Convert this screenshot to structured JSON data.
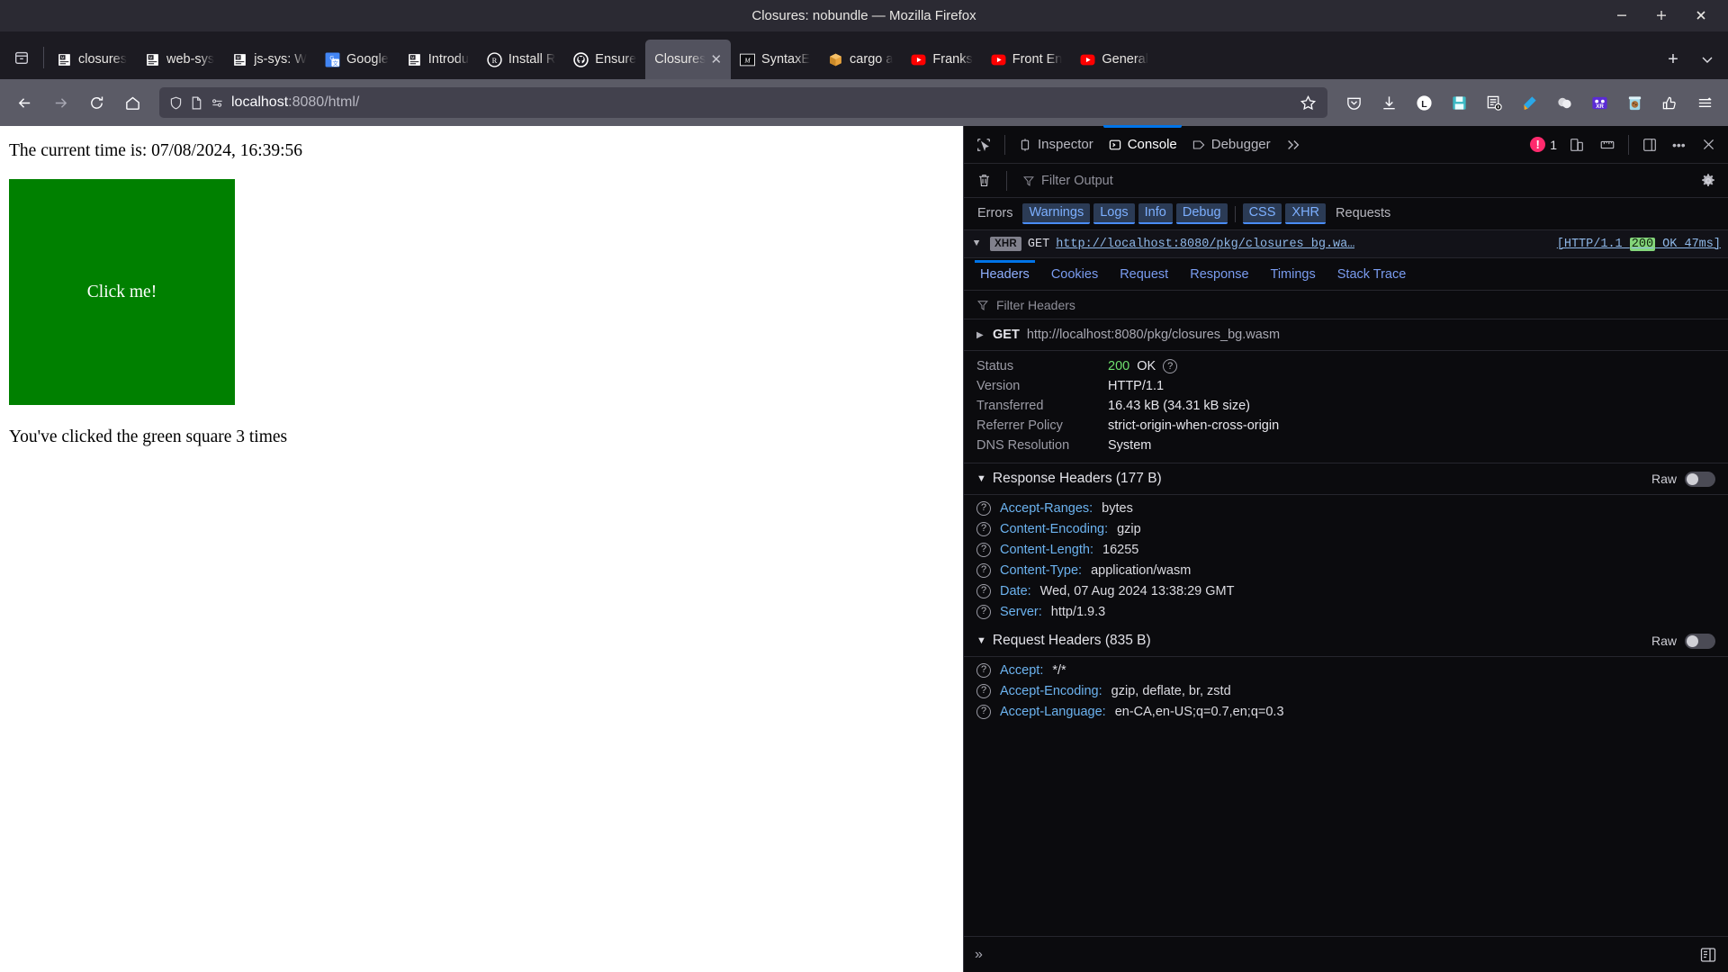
{
  "window": {
    "title": "Closures: nobundle — Mozilla Firefox",
    "minimize_label": "–",
    "maximize_label": "+",
    "close_label": "✕"
  },
  "tabstrip": {
    "list_all_tabs_label": "⌄",
    "new_tab_label": "+",
    "tabs": [
      {
        "title": "closures",
        "favicon": "book-icon",
        "active": false
      },
      {
        "title": "web-sys",
        "favicon": "book-icon",
        "active": false
      },
      {
        "title": "js-sys: W",
        "favicon": "book-icon",
        "active": false
      },
      {
        "title": "Google",
        "favicon": "google-translate-icon",
        "active": false
      },
      {
        "title": "Introdu",
        "favicon": "book-icon",
        "active": false
      },
      {
        "title": "Install R",
        "favicon": "rust-icon",
        "active": false
      },
      {
        "title": "Ensure",
        "favicon": "github-icon",
        "active": false
      },
      {
        "title": "Closures",
        "favicon": "none",
        "active": true,
        "close_label": "✕"
      },
      {
        "title": "SyntaxE",
        "favicon": "mdn-icon",
        "active": false
      },
      {
        "title": "cargo a",
        "favicon": "package-icon",
        "active": false
      },
      {
        "title": "Franks",
        "favicon": "youtube-icon",
        "active": false
      },
      {
        "title": "Front En",
        "favicon": "youtube-icon",
        "active": false
      },
      {
        "title": "General",
        "favicon": "youtube-icon",
        "active": false
      }
    ]
  },
  "navbar": {
    "back_label": "←",
    "forward_label": "→",
    "reload_label": "⟳",
    "home_label": "⌂",
    "url_host": "localhost",
    "url_path": ":8080/html/",
    "url_full": "localhost:8080/html/",
    "bookmark_label": "☆",
    "toolbar_icons": [
      "pocket-icon",
      "downloads-icon",
      "lastpass-icon",
      "save-page-icon",
      "readability-icon",
      "highlighter-icon",
      "ghost-privacy-icon",
      "webxr-icon",
      "cookie-jar-icon",
      "thumbs-up-icon",
      "app-menu-icon"
    ]
  },
  "page": {
    "time_text": "The current time is: 07/08/2024, 16:39:56",
    "button_label": "Click me!",
    "button_color": "#008000",
    "click_text": "You've clicked the green square 3 times"
  },
  "devtools": {
    "toolbar": {
      "picker_icon": "element-picker-icon",
      "panels": [
        {
          "label": "Inspector",
          "icon": "inspector-icon",
          "selected": false
        },
        {
          "label": "Console",
          "icon": "console-icon",
          "selected": true
        },
        {
          "label": "Debugger",
          "icon": "debugger-icon",
          "selected": false
        }
      ],
      "more_panels_label": "»",
      "error_count": "1",
      "error_badge_glyph": "!",
      "responsive_icon": "responsive-design-mode-icon",
      "ruler_icon": "measure-icon",
      "split_icon": "split-console-icon",
      "meatball_label": "•••",
      "close_label": "✕"
    },
    "filterbar": {
      "clear_icon": "trash-icon",
      "filter_placeholder": "Filter Output",
      "settings_icon": "gear-icon"
    },
    "levels": [
      {
        "label": "Errors",
        "active": false
      },
      {
        "label": "Warnings",
        "active": true
      },
      {
        "label": "Logs",
        "active": true
      },
      {
        "label": "Info",
        "active": true
      },
      {
        "label": "Debug",
        "active": true
      },
      {
        "label": "CSS",
        "active": true
      },
      {
        "label": "XHR",
        "active": true
      },
      {
        "label": "Requests",
        "active": false
      }
    ],
    "message": {
      "twisty": "▼",
      "badge": "XHR",
      "method": "GET",
      "url": "http://localhost:8080/pkg/closures_bg.wa…",
      "status_prefix": "[HTTP/1.1 ",
      "status_code": "200",
      "status_suffix": " OK 47ms]"
    },
    "net_tabs": [
      {
        "label": "Headers",
        "active": true
      },
      {
        "label": "Cookies",
        "active": false
      },
      {
        "label": "Request",
        "active": false
      },
      {
        "label": "Response",
        "active": false
      },
      {
        "label": "Timings",
        "active": false
      },
      {
        "label": "Stack Trace",
        "active": false
      }
    ],
    "headers_filter_placeholder": "Filter Headers",
    "request_line": {
      "twisty": "▶",
      "method": "GET",
      "url": "http://localhost:8080/pkg/closures_bg.wasm"
    },
    "summary": [
      {
        "label": "Status",
        "value": "200",
        "value2": "OK",
        "has_help": true
      },
      {
        "label": "Version",
        "value": "HTTP/1.1",
        "has_help": false
      },
      {
        "label": "Transferred",
        "value": "16.43 kB (34.31 kB size)",
        "has_help": false
      },
      {
        "label": "Referrer Policy",
        "value": "strict-origin-when-cross-origin",
        "has_help": false
      },
      {
        "label": "DNS Resolution",
        "value": "System",
        "has_help": false
      }
    ],
    "response_headers": {
      "title": "Response Headers (177 B)",
      "twisty": "▼",
      "raw_label": "Raw",
      "rows": [
        {
          "name": "Accept-Ranges:",
          "value": "bytes"
        },
        {
          "name": "Content-Encoding:",
          "value": "gzip"
        },
        {
          "name": "Content-Length:",
          "value": "16255"
        },
        {
          "name": "Content-Type:",
          "value": "application/wasm"
        },
        {
          "name": "Date:",
          "value": "Wed, 07 Aug 2024 13:38:29 GMT"
        },
        {
          "name": "Server:",
          "value": "http/1.9.3"
        }
      ]
    },
    "request_headers": {
      "title": "Request Headers (835 B)",
      "twisty": "▼",
      "raw_label": "Raw",
      "rows": [
        {
          "name": "Accept:",
          "value": "*/*"
        },
        {
          "name": "Accept-Encoding:",
          "value": "gzip, deflate, br, zstd"
        },
        {
          "name": "Accept-Language:",
          "value": "en-CA,en-US;q=0.7,en;q=0.3"
        }
      ]
    },
    "statusbar": {
      "chevron_label": "»",
      "layout_icon": "console-layout-icon"
    }
  },
  "colors": {
    "accent_blue": "#0074e8",
    "link_blue": "#6cb3f0",
    "success_green": "#84d67a",
    "error_pink": "#ff2a6d",
    "page_green": "#008000"
  }
}
